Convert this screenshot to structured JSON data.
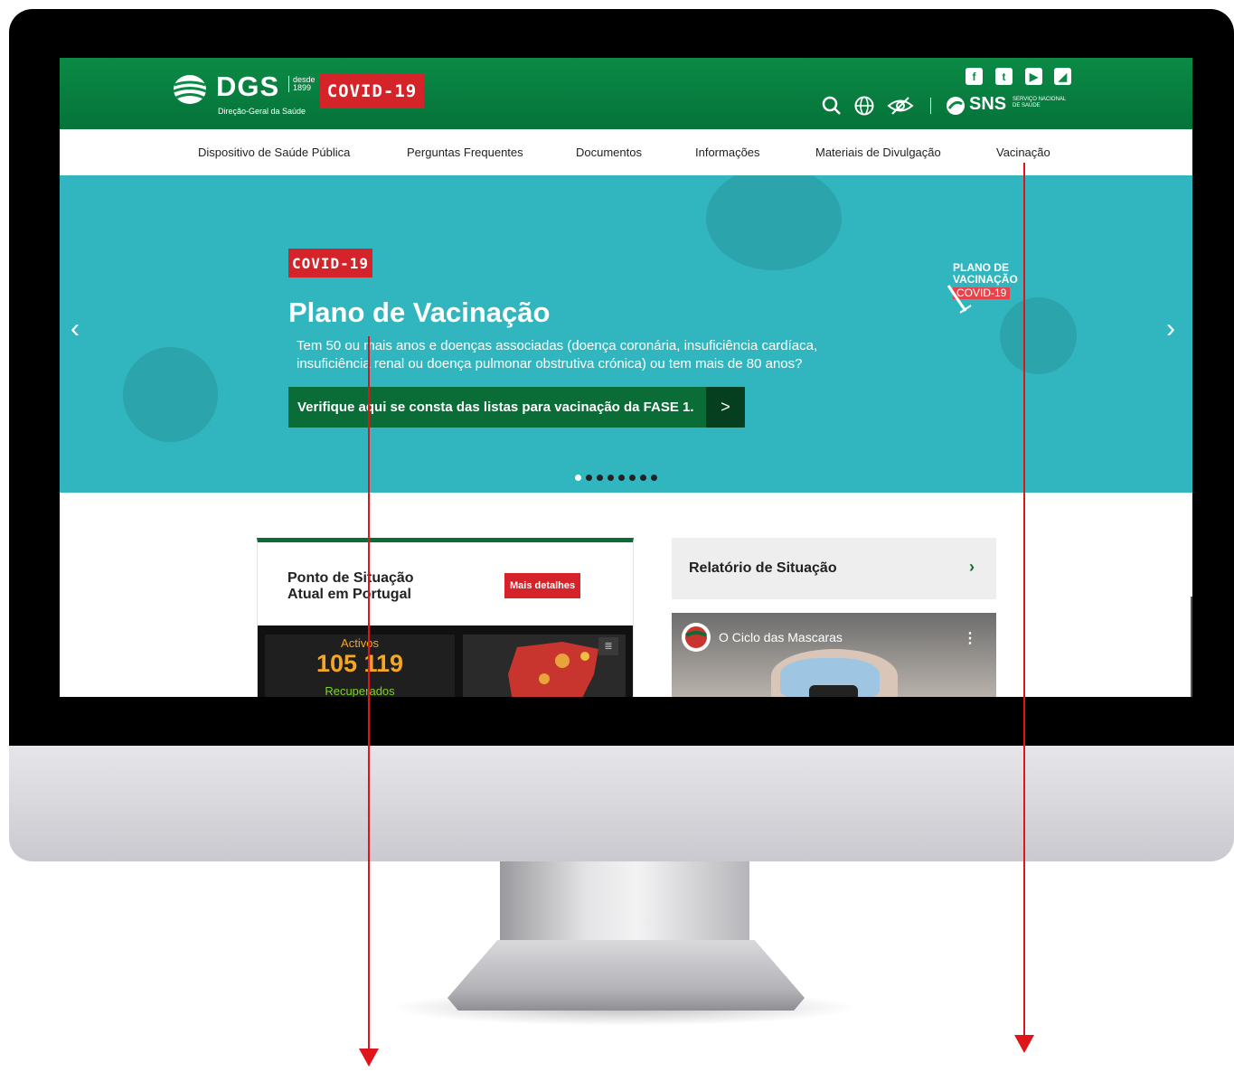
{
  "header": {
    "logo_text": "DGS",
    "logo_since_1": "desde",
    "logo_since_2": "1899",
    "logo_subtitle": "Direção-Geral da Saúde",
    "covid_badge": "COVID-19",
    "sns_text": "SNS",
    "sns_subtitle_1": "SERVIÇO NACIONAL",
    "sns_subtitle_2": "DE SAÚDE"
  },
  "nav": {
    "items": [
      "Dispositivo de Saúde Pública",
      "Perguntas Frequentes",
      "Documentos",
      "Informações",
      "Materiais de Divulgação",
      "Vacinação"
    ]
  },
  "hero": {
    "badge": "COVID-19",
    "title": "Plano de Vacinação",
    "description": "Tem 50 ou mais anos e doenças associadas (doença coronária, insuficiência cardíaca, insuficiência renal ou doença pulmonar obstrutiva crónica) ou tem mais de 80 anos?",
    "cta_label": "Verifique aqui se consta das listas para vacinação da FASE 1.",
    "cta_arrow": ">",
    "plan_badge_1": "PLANO DE",
    "plan_badge_2": "VACINAÇÃO",
    "plan_badge_3": "COVID-19",
    "prev_arrow": "‹",
    "next_arrow": "›",
    "slide_count": 8,
    "active_slide": 1
  },
  "situation_card": {
    "title_1": "Ponto de Situação",
    "title_2": "Atual em Portugal",
    "details_button": "Mais detalhes",
    "active_label": "Activos",
    "active_value": "105 119",
    "recovered_label": "Recuperados"
  },
  "report_card": {
    "title": "Relatório de Situação",
    "chevron": "›"
  },
  "video": {
    "title": "O Ciclo das Mascaras"
  },
  "colors": {
    "brand_green": "#0a6c36",
    "header_green": "#0b8a45",
    "hero_teal": "#31b6bf",
    "covid_red": "#d5232a",
    "arrow_red": "#e0141b"
  }
}
